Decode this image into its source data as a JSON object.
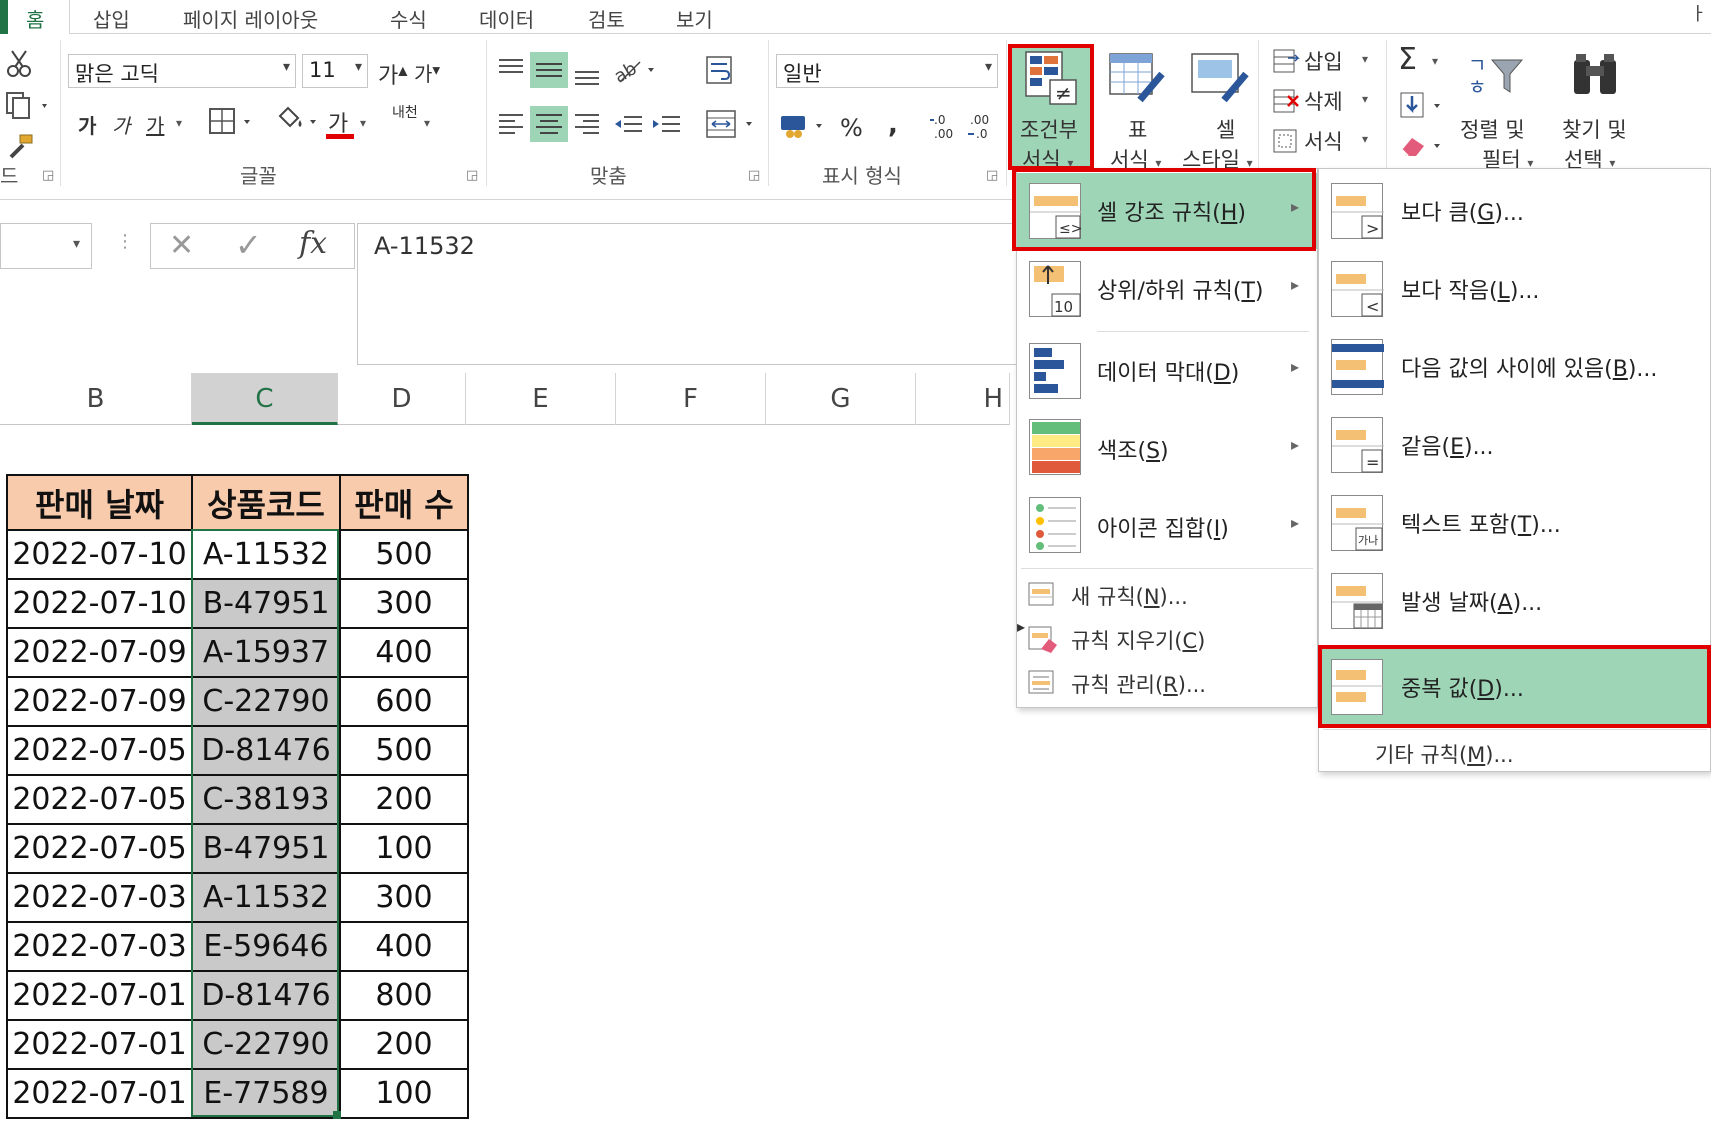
{
  "tabs": [
    {
      "label": "홈"
    },
    {
      "label": "삽입"
    },
    {
      "label": "페이지 레이아웃"
    },
    {
      "label": "수식"
    },
    {
      "label": "데이터"
    },
    {
      "label": "검토"
    },
    {
      "label": "보기"
    }
  ],
  "ribbon": {
    "clipboard": {
      "partial_label": "드"
    },
    "font": {
      "group_label": "글꼴",
      "font_name": "맑은 고딕",
      "font_size": "11",
      "grow_label": "가",
      "shrink_label": "가",
      "bold_label": "가",
      "italic_label": "가",
      "underline_label": "가",
      "font_color_label": "가",
      "phonetic_label": "내천"
    },
    "alignment": {
      "group_label": "맞춤"
    },
    "number": {
      "group_label": "표시 형식",
      "format": "일반",
      "percent_label": "%",
      "comma_label": ","
    },
    "styles": {
      "conditional_label_1": "조건부",
      "conditional_label_2": "서식",
      "table_label_1": "표",
      "table_label_2": "서식",
      "cell_label_1": "셀",
      "cell_label_2": "스타일"
    },
    "cells": {
      "insert_label": "삽입",
      "delete_label": "삭제",
      "format_label": "서식"
    },
    "editing": {
      "sum_label": "Σ",
      "sort_label_1": "정렬 및",
      "sort_label_2": "필터",
      "find_label_1": "찾기 및",
      "find_label_2": "선택"
    }
  },
  "formula_bar": {
    "fx_label": "fx",
    "value": "A-11532"
  },
  "columns": [
    "B",
    "C",
    "D",
    "E",
    "F",
    "G",
    "H"
  ],
  "table": {
    "headers": [
      "판매 날짜",
      "상품코드",
      "판매 수"
    ],
    "rows": [
      [
        "2022-07-10",
        "A-11532",
        "500"
      ],
      [
        "2022-07-10",
        "B-47951",
        "300"
      ],
      [
        "2022-07-09",
        "A-15937",
        "400"
      ],
      [
        "2022-07-09",
        "C-22790",
        "600"
      ],
      [
        "2022-07-05",
        "D-81476",
        "500"
      ],
      [
        "2022-07-05",
        "C-38193",
        "200"
      ],
      [
        "2022-07-05",
        "B-47951",
        "100"
      ],
      [
        "2022-07-03",
        "A-11532",
        "300"
      ],
      [
        "2022-07-03",
        "E-59646",
        "400"
      ],
      [
        "2022-07-01",
        "D-81476",
        "800"
      ],
      [
        "2022-07-01",
        "C-22790",
        "200"
      ],
      [
        "2022-07-01",
        "E-77589",
        "100"
      ]
    ]
  },
  "cf_menu": {
    "items": [
      {
        "label": "셀 강조 규칙(",
        "key": "H",
        "tail": ")"
      },
      {
        "label": "상위/하위 규칙(",
        "key": "T",
        "tail": ")"
      },
      {
        "label": "데이터 막대(",
        "key": "D",
        "tail": ")"
      },
      {
        "label": "색조(",
        "key": "S",
        "tail": ")"
      },
      {
        "label": "아이콘 집합(",
        "key": "I",
        "tail": ")"
      }
    ],
    "small_items": [
      {
        "label": "새 규칙(",
        "key": "N",
        "tail": ")..."
      },
      {
        "label": "규칙 지우기(",
        "key": "C",
        "tail": ")"
      },
      {
        "label": "규칙 관리(",
        "key": "R",
        "tail": ")..."
      }
    ],
    "top_icon_number": "10"
  },
  "sub_menu": {
    "items": [
      {
        "label": "보다 큼(",
        "key": "G",
        "tail": ")..."
      },
      {
        "label": "보다 작음(",
        "key": "L",
        "tail": ")..."
      },
      {
        "label": "다음 값의 사이에 있음(",
        "key": "B",
        "tail": ")..."
      },
      {
        "label": "같음(",
        "key": "E",
        "tail": ")..."
      },
      {
        "label": "텍스트 포함(",
        "key": "T",
        "tail": ")..."
      },
      {
        "label": "발생 날짜(",
        "key": "A",
        "tail": ")..."
      },
      {
        "label": "중복 값(",
        "key": "D",
        "tail": ")..."
      }
    ],
    "more_label": "기타 규칙(",
    "more_key": "M",
    "more_tail": ")...",
    "text_icon_label": "가나"
  },
  "colors": {
    "accent": "#217346",
    "highlight": "#9fd5b7",
    "red_outline": "#e00000",
    "header_fill": "#f8cbad",
    "selected_fill": "#c9c9c9"
  }
}
